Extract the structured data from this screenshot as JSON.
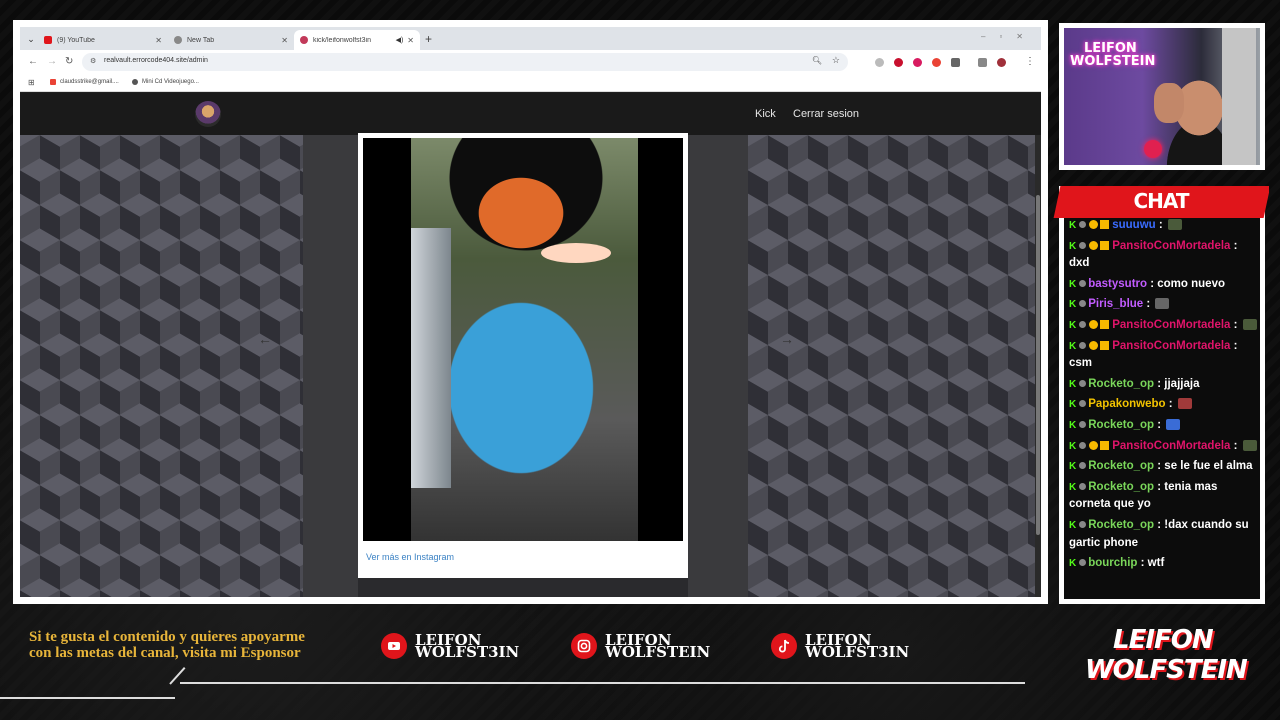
{
  "browser": {
    "tabs": [
      {
        "label": "(9) YouTube",
        "active": false
      },
      {
        "label": "New Tab",
        "active": false
      },
      {
        "label": "kick/leifonwolfst3in",
        "active": true
      }
    ],
    "url": "realvault.errorcode404.site/admin",
    "bookmarks": [
      "claudsstrike@gmail....",
      "Mini Cd Videojuego..."
    ]
  },
  "site": {
    "nav_kick": "Kick",
    "nav_logout": "Cerrar sesion",
    "embed_link": "Ver más en Instagram"
  },
  "cam": {
    "overlay_logo_line1": "LEIFON",
    "overlay_logo_line2": "WOLFSTEIN"
  },
  "chat": {
    "title": "CHAT",
    "messages": [
      {
        "user": "suuuwu",
        "color": "#3a6cff",
        "text": "",
        "emote": "#4a5a3a",
        "sub": true
      },
      {
        "user": "PansitoConMortadela",
        "color": "#e0146a",
        "text": "dxd",
        "emote": "",
        "sub": true
      },
      {
        "user": "bastysutro",
        "color": "#c25cff",
        "text": "como nuevo",
        "emote": "",
        "sub": false
      },
      {
        "user": "Piris_blue",
        "color": "#c25cff",
        "text": "",
        "emote": "#666666",
        "sub": false
      },
      {
        "user": "PansitoConMortadela",
        "color": "#e0146a",
        "text": "",
        "emote": "#4a5a3a",
        "sub": true
      },
      {
        "user": "PansitoConMortadela",
        "color": "#e0146a",
        "text": "csm",
        "emote": "",
        "sub": true
      },
      {
        "user": "Rocketo_op",
        "color": "#7ad65a",
        "text": "jjajjaja",
        "emote": "",
        "sub": false
      },
      {
        "user": "Papakonwebo",
        "color": "#f2c300",
        "text": "",
        "emote": "#a03a3a",
        "sub": false
      },
      {
        "user": "Rocketo_op",
        "color": "#7ad65a",
        "text": "",
        "emote": "#3a6cd6",
        "sub": false
      },
      {
        "user": "PansitoConMortadela",
        "color": "#e0146a",
        "text": "",
        "emote": "#4a5a3a",
        "sub": true
      },
      {
        "user": "Rocketo_op",
        "color": "#7ad65a",
        "text": "se le fue el alma",
        "emote": "",
        "sub": false
      },
      {
        "user": "Rocketo_op",
        "color": "#7ad65a",
        "text": "tenia mas corneta que yo",
        "emote": "",
        "sub": false
      },
      {
        "user": "Rocketo_op",
        "color": "#7ad65a",
        "text": "!dax cuando su gartic phone",
        "emote": "",
        "sub": false
      },
      {
        "user": "bourchip",
        "color": "#7ad65a",
        "text": "wtf",
        "emote": "",
        "sub": false
      }
    ]
  },
  "footer": {
    "sponsor_text": "Si te gusta el contenido y quieres apoyarme con las metas del canal, visita mi Esponsor",
    "socials": [
      {
        "icon": "youtube-icon",
        "line1": "LEIFON",
        "line2": "WOLFST3IN"
      },
      {
        "icon": "instagram-icon",
        "line1": "LEIFON",
        "line2": "WOLFSTEIN"
      },
      {
        "icon": "tiktok-icon",
        "line1": "LEIFON",
        "line2": "WOLFST3IN"
      }
    ],
    "brand_line1": "LEIFON",
    "brand_line2": "WOLFSTEIN"
  }
}
